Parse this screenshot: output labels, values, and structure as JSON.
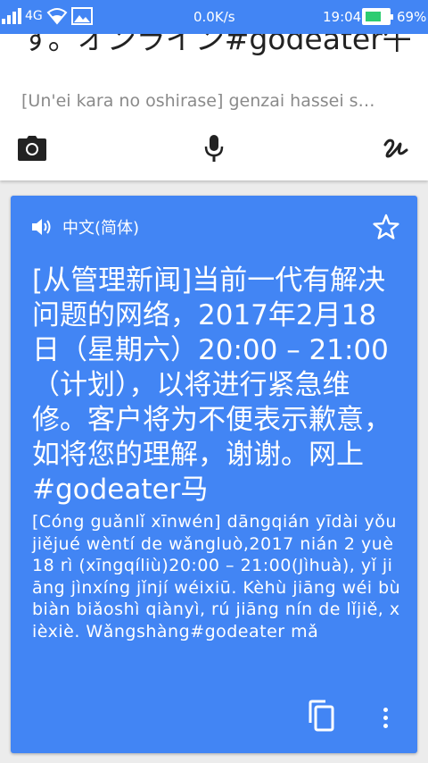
{
  "status_bar": {
    "network_type": "4G",
    "net_speed": "0.0K/s",
    "time": "19:04",
    "battery_percent": "69%",
    "battery_level": 0.69,
    "accent_color": "#4285f4"
  },
  "input_card": {
    "source_text": "す。オンライン#godeater午",
    "transliteration": "[Un'ei kara no oshirase] genzai hassei s…",
    "tools": {
      "camera_icon": "camera-icon",
      "mic_icon": "microphone-icon",
      "handwriting_icon": "handwriting-icon"
    }
  },
  "result_card": {
    "target_language": "中文(简体)",
    "translation": "[从管理新闻]当前一代有解决问题的网络，2017年2月18日（星期六）20:00 – 21:00（计划），以将进行紧急维修。客户将为不便表示歉意，如将您的理解，谢谢。网上#godeater马",
    "pinyin": "[Cóng guǎnlǐ xīnwén] dāngqián yīdài yǒu jiějué wèntí de wǎngluò,2017 nián 2 yuè 18 rì (xīngqíliù)20:00 – 21:00(Jìhuà), yǐ jiāng jìnxíng jǐnjí wéixiū. Kèhù jiāng wéi bù biàn biǎoshì qiànyì, rú jiāng nín de lǐjiě, xièxiè. Wǎngshàng#godeater mǎ",
    "card_color": "#4285f4"
  }
}
